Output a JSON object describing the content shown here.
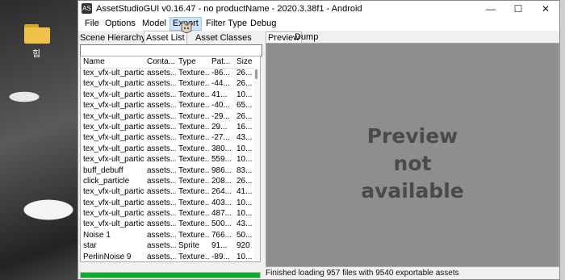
{
  "desktop": {
    "folder_label": "힘"
  },
  "window": {
    "title": "AssetStudioGUI v0.16.47 - no productName - 2020.3.38f1 - Android",
    "minimize": "—",
    "maximize": "☐",
    "close": "✕"
  },
  "menu": [
    "File",
    "Options",
    "Model",
    "Export",
    "Filter Type",
    "Debug"
  ],
  "menu_active": "Export",
  "left_tabs": [
    "Scene Hierarchy",
    "Asset List",
    "Asset Classes"
  ],
  "left_tab_selected": "Asset List",
  "search": {
    "value": ""
  },
  "columns": [
    "Name",
    "Conta...",
    "Type",
    "Pat...",
    "Size"
  ],
  "rows": [
    [
      "tex_vfx-ult_partic...",
      "assets...",
      "Texture...",
      "-86...",
      "26..."
    ],
    [
      "tex_vfx-ult_partic...",
      "assets...",
      "Texture...",
      "-44...",
      "26..."
    ],
    [
      "tex_vfx-ult_partic...",
      "assets...",
      "Texture...",
      "41...",
      "10..."
    ],
    [
      "tex_vfx-ult_partic...",
      "assets...",
      "Texture...",
      "-40...",
      "65..."
    ],
    [
      "tex_vfx-ult_partic...",
      "assets...",
      "Texture...",
      "-29...",
      "26..."
    ],
    [
      "tex_vfx-ult_partic...",
      "assets...",
      "Texture...",
      "29...",
      "16..."
    ],
    [
      "tex_vfx-ult_partic...",
      "assets...",
      "Texture...",
      "-27...",
      "43..."
    ],
    [
      "tex_vfx-ult_partic...",
      "assets...",
      "Texture...",
      "380...",
      "10..."
    ],
    [
      "tex_vfx-ult_partic...",
      "assets...",
      "Texture...",
      "559...",
      "10..."
    ],
    [
      "buff_debuff",
      "assets...",
      "Texture...",
      "986...",
      "83..."
    ],
    [
      "click_particle",
      "assets...",
      "Texture...",
      "208...",
      "26..."
    ],
    [
      "tex_vfx-ult_partic...",
      "assets...",
      "Texture...",
      "264...",
      "41..."
    ],
    [
      "tex_vfx-ult_partic...",
      "assets...",
      "Texture...",
      "403...",
      "10..."
    ],
    [
      "tex_vfx-ult_partic...",
      "assets...",
      "Texture...",
      "487...",
      "10..."
    ],
    [
      "tex_vfx-ult_partic...",
      "assets...",
      "Texture...",
      "500...",
      "43..."
    ],
    [
      "Noise 1",
      "assets...",
      "Texture...",
      "766...",
      "50..."
    ],
    [
      "star",
      "assets...",
      "Sprite",
      "91...",
      "920"
    ],
    [
      "PerlinNoise 9",
      "assets...",
      "Texture...",
      "-89...",
      "10..."
    ]
  ],
  "progress": {
    "percent": 100,
    "color": "#06b025"
  },
  "right_tabs": [
    "Preview",
    "Dump"
  ],
  "right_tab_selected": "Preview",
  "preview_lines": [
    "Preview",
    "not",
    "available"
  ],
  "status": "Finished loading 957 files with 9540 exportable assets"
}
